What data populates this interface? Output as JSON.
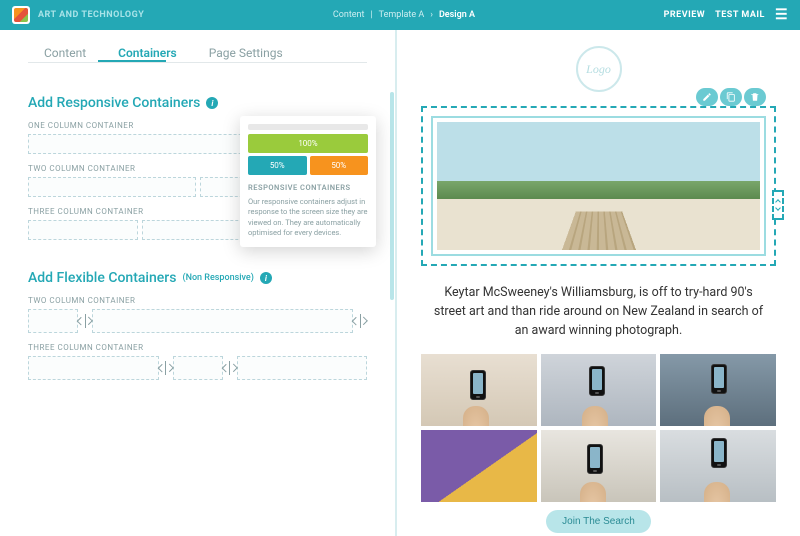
{
  "topbar": {
    "brand": "ART AND TECHNOLOGY",
    "crumb1": "Content",
    "crumb2": "Template A",
    "crumb3": "Design A",
    "preview": "PREVIEW",
    "testmail": "TEST MAIL"
  },
  "tabs": {
    "content": "Content",
    "containers": "Containers",
    "settings": "Page Settings"
  },
  "left": {
    "sec1": "Add Responsive Containers",
    "one": "ONE COLUMN CONTAINER",
    "two": "TWO COLUMN CONTAINER",
    "three": "THREE COLUMN CONTAINER",
    "sec2": "Add Flexible Containers",
    "sec2sub": "(Non Responsive)"
  },
  "tooltip": {
    "b100": "100%",
    "b50": "50%",
    "title": "RESPONSIVE CONTAINERS",
    "body": "Our responsive containers adjust in response to the screen size they are viewed on. They are automatically optimised for every devices."
  },
  "preview": {
    "logo": "Logo",
    "copy": "Keytar McSweeney's Williamsburg, is off to try-hard 90's street art and than ride around on New Zealand in search of an award winning photograph.",
    "cta": "Join The Search"
  }
}
